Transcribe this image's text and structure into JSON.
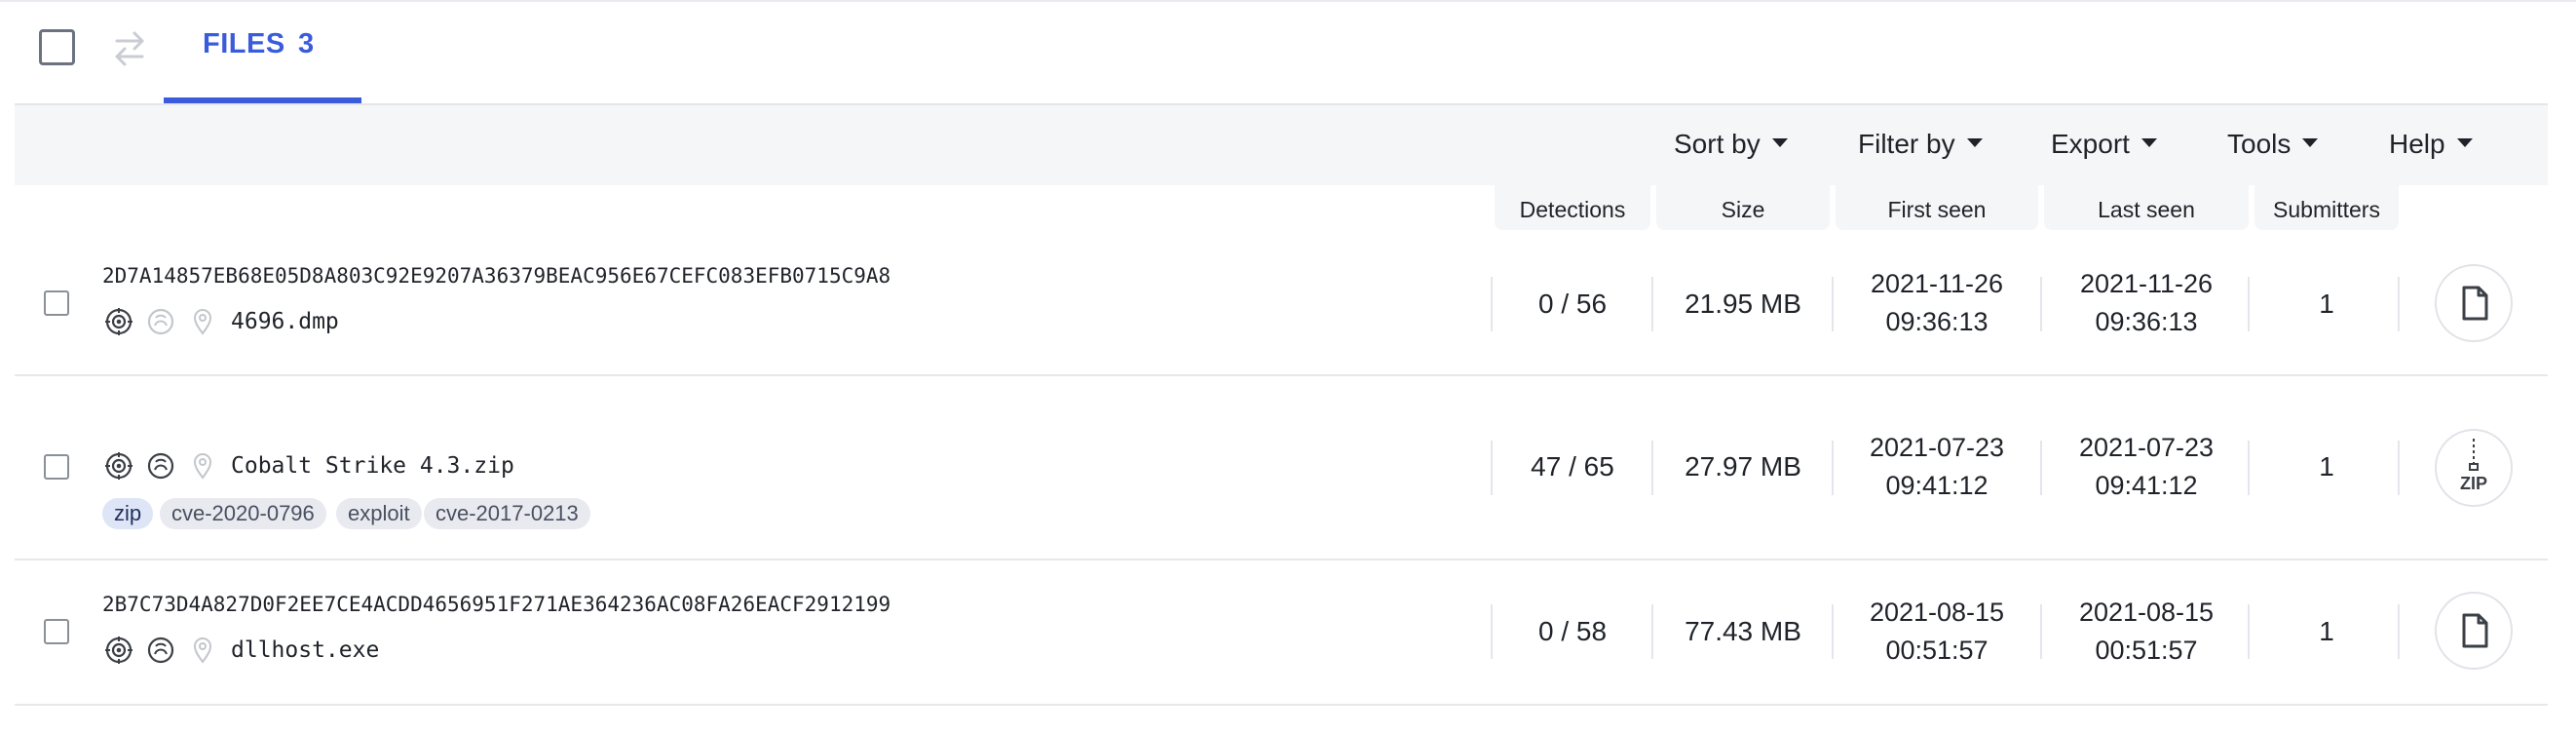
{
  "tabs": {
    "files_label": "FILES",
    "files_count": "3"
  },
  "toolbar": {
    "sort_by": "Sort by",
    "filter_by": "Filter by",
    "export": "Export",
    "tools": "Tools",
    "help": "Help"
  },
  "columns": {
    "detections": "Detections",
    "size": "Size",
    "first_seen": "First seen",
    "last_seen": "Last seen",
    "submitters": "Submitters"
  },
  "rows": [
    {
      "hash": "2D7A14857EB68E05D8A803C92E9207A36379BEAC956E67CEFC083EFB0715C9A8",
      "name": "4696.dmp",
      "detections": "0 / 56",
      "size": "21.95 MB",
      "first_seen_date": "2021-11-26",
      "first_seen_time": "09:36:13",
      "last_seen_date": "2021-11-26",
      "last_seen_time": "09:36:13",
      "submitters": "1",
      "type_icon": "document-icon"
    },
    {
      "hash": "",
      "name": "Cobalt Strike 4.3.zip",
      "tags": [
        "zip",
        "cve-2020-0796",
        "exploit",
        "cve-2017-0213"
      ],
      "detections": "47 / 65",
      "size": "27.97 MB",
      "first_seen_date": "2021-07-23",
      "first_seen_time": "09:41:12",
      "last_seen_date": "2021-07-23",
      "last_seen_time": "09:41:12",
      "submitters": "1",
      "type_icon": "zip-icon",
      "type_label": "ZIP"
    },
    {
      "hash": "2B7C73D4A827D0F2EE7CE4ACDD4656951F271AE364236AC08FA26EACF2912199",
      "name": "dllhost.exe",
      "detections": "0 / 58",
      "size": "77.43 MB",
      "first_seen_date": "2021-08-15",
      "first_seen_time": "00:51:57",
      "last_seen_date": "2021-08-15",
      "last_seen_time": "00:51:57",
      "submitters": "1",
      "type_icon": "document-icon"
    }
  ],
  "colors": {
    "accent": "#3a5bdc",
    "toolbar_bg": "#f5f6f8",
    "tag_bg": "#e8eaf0",
    "tag_primary_bg": "#dde5f7"
  }
}
